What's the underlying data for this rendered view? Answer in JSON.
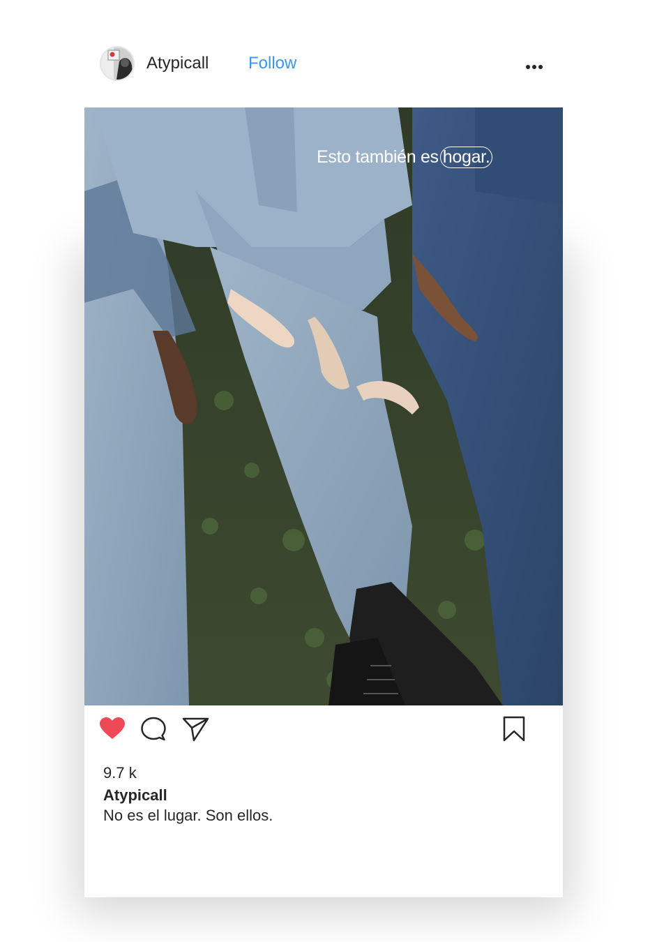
{
  "post": {
    "username": "Atypicall",
    "follow_label": "Follow",
    "overlay_text": "Esto también es",
    "overlay_text_highlight": "hogar.",
    "likes": "9.7 k",
    "caption_user": "Atypicall",
    "caption_text": "No es el lugar. Son ellos."
  },
  "icons": {
    "more": "more-horizontal-icon",
    "like": "heart-icon",
    "comment": "comment-bubble-icon",
    "share": "paper-plane-icon",
    "save": "bookmark-icon"
  },
  "colors": {
    "like_active": "#ed4956",
    "follow": "#3897f0",
    "text": "#262626"
  }
}
